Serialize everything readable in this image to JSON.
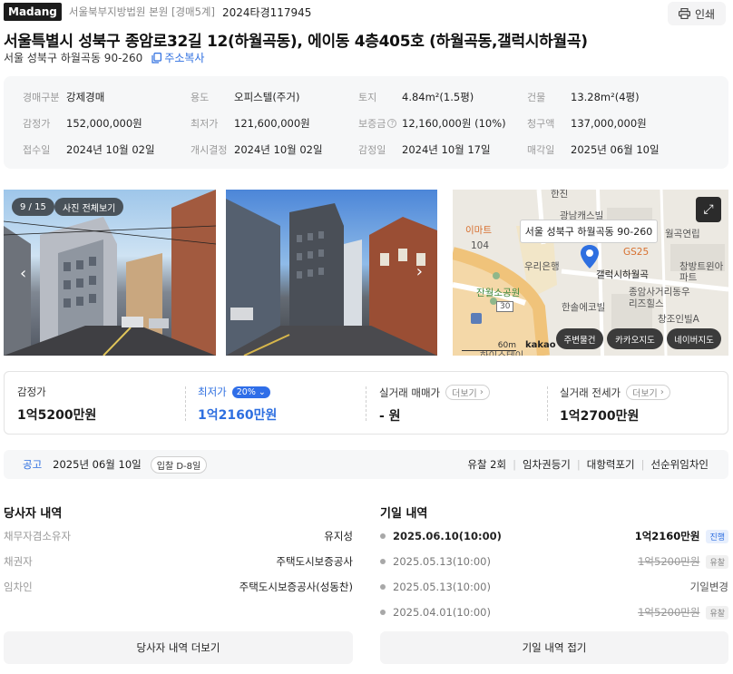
{
  "header": {
    "logo": "Madang",
    "court": "서울북부지방법원 본원 [경매5계]",
    "case_no": "2024타경117945",
    "print_label": "인쇄"
  },
  "property": {
    "title": "서울특별시 성북구 종암로32길 12(하월곡동), 에이동 4층405호 (하월곡동,갤럭시하월곡)",
    "jibun_address": "서울 성북구 하월곡동 90-260",
    "copy_label": "주소복사"
  },
  "info": [
    [
      {
        "k": "경매구분",
        "v": "강제경매"
      },
      {
        "k": "용도",
        "v": "오피스텔(주거)"
      },
      {
        "k": "토지",
        "v": "4.84m²(1.5평)"
      },
      {
        "k": "건물",
        "v": "13.28m²(4평)"
      }
    ],
    [
      {
        "k": "감정가",
        "v": "152,000,000원"
      },
      {
        "k": "최저가",
        "v": "121,600,000원"
      },
      {
        "k": "보증금",
        "v": "12,160,000원 (10%)"
      },
      {
        "k": "청구액",
        "v": "137,000,000원"
      }
    ],
    [
      {
        "k": "접수일",
        "v": "2024년 10월 02일"
      },
      {
        "k": "개시결정",
        "v": "2024년 10월 02일"
      },
      {
        "k": "감정일",
        "v": "2024년 10월 17일"
      },
      {
        "k": "매각일",
        "v": "2025년 06월 10일"
      }
    ]
  ],
  "gallery": {
    "counter": "9 / 15",
    "view_all": "사진 전체보기"
  },
  "map": {
    "address_popup": "서울 성북구 하월곡동 90-260",
    "labels": [
      "한진",
      "광남캐스빌",
      "이마트",
      "104",
      "GS25",
      "월곡연립",
      "우리은행",
      "갤럭시하월곡",
      "창방트윈아파트",
      "잔월소공원",
      "종암사거리동우리즈힐스",
      "한솔에코빌",
      "창조인빌A",
      "30",
      "하이스테이"
    ],
    "scale": "60m",
    "provider": "kakao",
    "buttons": [
      "주변물건",
      "카카오지도",
      "네이버지도"
    ]
  },
  "prices": {
    "appraisal_label": "감정가",
    "appraisal_value": "1억5200만원",
    "min_label": "최저가",
    "min_pct": "20%",
    "min_value": "1억2160만원",
    "trade_label": "실거래 매매가",
    "trade_value": "- 원",
    "jeonse_label": "실거래 전세가",
    "jeonse_value": "1억2700만원",
    "more_label": "더보기"
  },
  "notice": {
    "label": "공고",
    "date": "2025년 06월 10일",
    "dday": "입찰 D-8일",
    "links": [
      "유찰 2회",
      "임차권등기",
      "대항력포기",
      "선순위임차인"
    ]
  },
  "parties": {
    "title": "당사자 내역",
    "rows": [
      {
        "k": "채무자겸소유자",
        "v": "유지성"
      },
      {
        "k": "채권자",
        "v": "주택도시보증공사"
      },
      {
        "k": "임차인",
        "v": "주택도시보증공사(성동찬)"
      }
    ],
    "more_button": "당사자 내역 더보기"
  },
  "auction": {
    "title": "기일 내역",
    "rows": [
      {
        "date": "2025.06.10(10:00)",
        "price": "1억2160만원",
        "badge": "진행"
      },
      {
        "date": "2025.05.13(10:00)",
        "price": "1억5200만원",
        "badge": "유찰"
      },
      {
        "date": "2025.05.13(10:00)",
        "change": "기일변경"
      },
      {
        "date": "2025.04.01(10:00)",
        "price": "1억5200만원",
        "badge": "유찰"
      }
    ],
    "collapse_button": "기일 내역 접기"
  },
  "colors": {
    "accent": "#2e6fe0",
    "logo_bg": "#1c1c1c"
  }
}
